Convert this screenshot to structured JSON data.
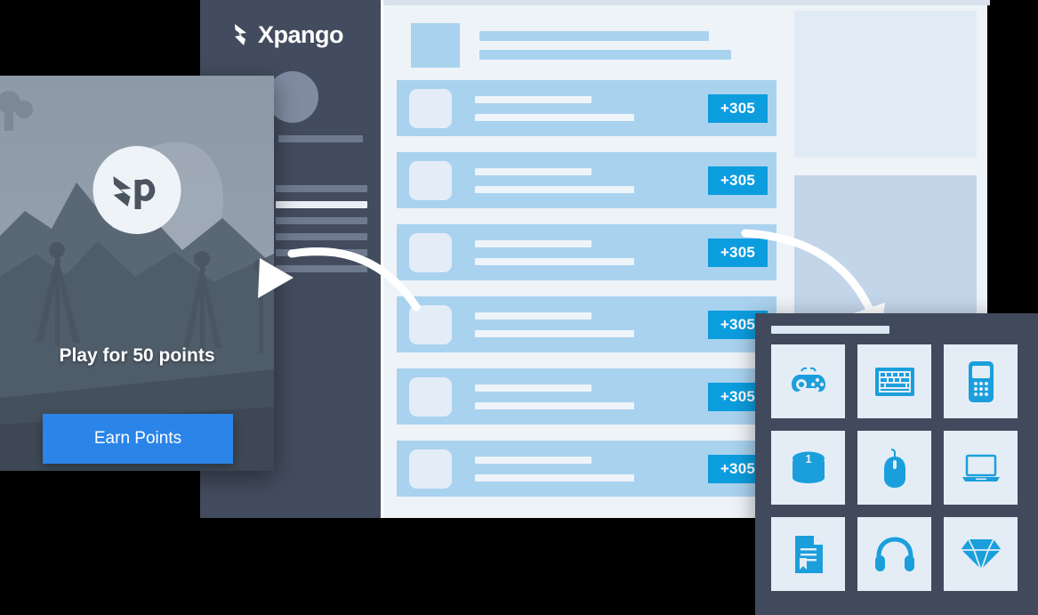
{
  "brand": {
    "name": "Xpango",
    "logo_icon": "xpango-x-logo-icon"
  },
  "sidebar": {
    "avatar_icon": "user-avatar-icon",
    "nav_items": [
      {
        "id": "nav-1",
        "active": false
      },
      {
        "id": "nav-2",
        "active": false
      },
      {
        "id": "nav-3",
        "active": true
      },
      {
        "id": "nav-4",
        "active": false
      },
      {
        "id": "nav-5",
        "active": false
      },
      {
        "id": "nav-6",
        "active": false
      },
      {
        "id": "nav-7",
        "active": false
      }
    ]
  },
  "offer_list": {
    "summary_row": {
      "thumb_icon": "summary-thumbnail-placeholder"
    },
    "rows": [
      {
        "badge": "+305"
      },
      {
        "badge": "+305"
      },
      {
        "badge": "+305"
      },
      {
        "badge": "+305"
      },
      {
        "badge": "+305"
      },
      {
        "badge": "+305"
      }
    ]
  },
  "right_rail": {
    "cards": [
      {
        "id": "rail-card-top"
      },
      {
        "id": "rail-card-bottom"
      }
    ]
  },
  "promo_card": {
    "logo_icon": "xp-badge-icon",
    "logo_text": "Xp",
    "title": "Play for 50 points",
    "button_label": "Earn Points"
  },
  "rewards_panel": {
    "title_placeholder": "",
    "tiles": [
      {
        "icon": "gamepad-icon",
        "label": "Gamepad"
      },
      {
        "icon": "keyboard-icon",
        "label": "Keyboard"
      },
      {
        "icon": "mobile-phone-icon",
        "label": "Mobile Phone"
      },
      {
        "icon": "coin-stack-icon",
        "label": "Coins",
        "coin_value": "1"
      },
      {
        "icon": "computer-mouse-icon",
        "label": "Mouse"
      },
      {
        "icon": "laptop-icon",
        "label": "Laptop"
      },
      {
        "icon": "certificate-document-icon",
        "label": "Certificate"
      },
      {
        "icon": "headphones-icon",
        "label": "Headphones"
      },
      {
        "icon": "diamond-icon",
        "label": "Diamond"
      }
    ]
  },
  "annotations": {
    "arrow_left_icon": "curved-arrow-left-icon",
    "arrow_right_icon": "curved-arrow-right-icon"
  },
  "colors": {
    "dark_panel": "#434c5e",
    "rewards_panel": "#414a5c",
    "accent_blue": "#0c9ddf",
    "button_blue": "#2b84e8",
    "row_blue": "#a9d2ef",
    "panel_bg": "#eef3f8",
    "icon_blue": "#1a9fdc"
  }
}
